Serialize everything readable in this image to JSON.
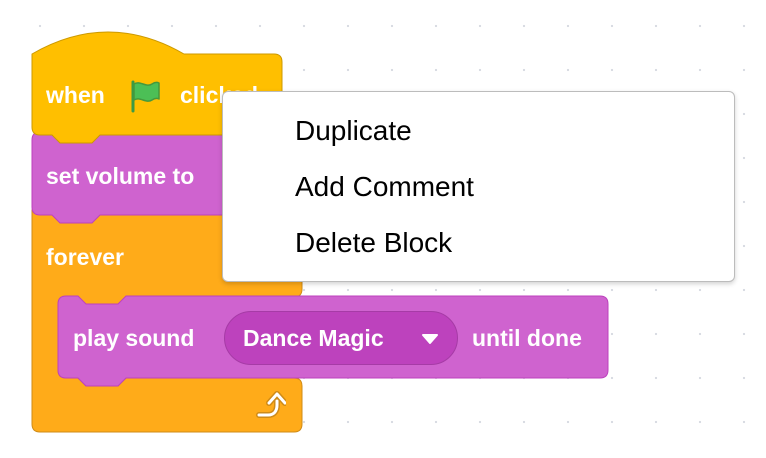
{
  "script": {
    "hat_block": {
      "text_before": "when",
      "text_after": "clicked",
      "icon": "green-flag-icon"
    },
    "volume_block": {
      "text": "set volume to"
    },
    "forever_block": {
      "label": "forever",
      "loop_icon": "loop-arrow-icon"
    },
    "sound_block": {
      "text_before": "play sound",
      "dropdown_value": "Dance Magic",
      "text_after": "until done"
    }
  },
  "context_menu": {
    "items": [
      {
        "label": "Duplicate"
      },
      {
        "label": "Add Comment"
      },
      {
        "label": "Delete Block"
      }
    ]
  },
  "colors": {
    "events": "#ffbf00",
    "events_border": "#cc9900",
    "sound": "#cf63cf",
    "sound_border": "#bd42bd",
    "control": "#ffab19",
    "control_border": "#cf8b17",
    "flag": "#4cbf56"
  }
}
